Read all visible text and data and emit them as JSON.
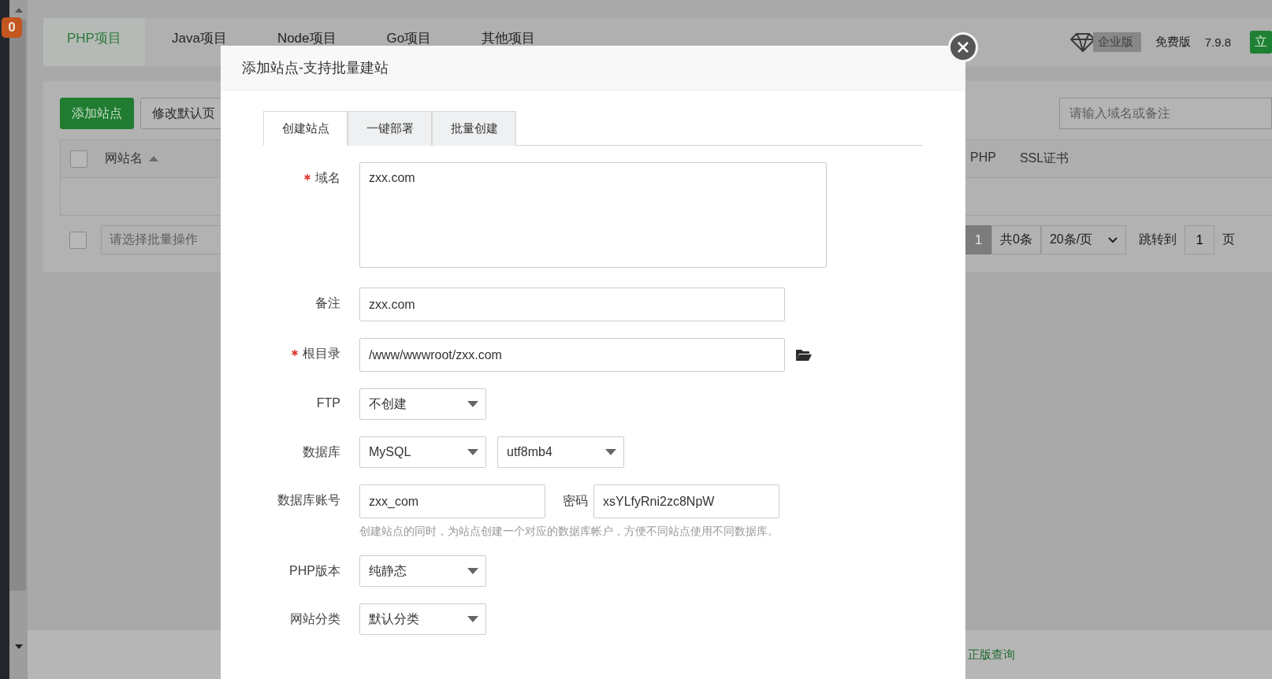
{
  "sidebar": {
    "badge": "0"
  },
  "project_tabs": [
    {
      "label": "PHP项目",
      "selected": true
    },
    {
      "label": "Java项目",
      "selected": false
    },
    {
      "label": "Node项目",
      "selected": false
    },
    {
      "label": "Go项目",
      "selected": false
    },
    {
      "label": "其他项目",
      "selected": false
    }
  ],
  "header_right": {
    "edition": "企业版",
    "plan": "免费版",
    "version": "7.9.8",
    "button": "立"
  },
  "toolbar": {
    "buttons": [
      {
        "label": "添加站点",
        "kind": "primary"
      },
      {
        "label": "修改默认页",
        "kind": "default"
      }
    ],
    "search": {
      "placeholder": "请输入域名或备注"
    }
  },
  "table": {
    "select_all": {
      "checked": false
    },
    "columns": [
      {
        "label": "网站名",
        "sorted": true
      },
      {
        "label": "PHP"
      },
      {
        "label": "SSL证书"
      }
    ]
  },
  "batch": {
    "checked": false,
    "placeholder": "请选择批量操作"
  },
  "pagination": {
    "pages": [
      {
        "label": "1",
        "selected": true
      }
    ],
    "total": "共0条",
    "page_size": "20条/页",
    "jump_label": "跳转到",
    "jump_value": "1",
    "page_unit": "页"
  },
  "footer_link": "正版查询",
  "dialog": {
    "title": "添加站点-支持批量建站",
    "tabs": [
      {
        "label": "创建站点",
        "selected": true
      },
      {
        "label": "一键部署",
        "selected": false
      },
      {
        "label": "批量创建",
        "selected": false
      }
    ],
    "fields": [
      {
        "kind": "textarea",
        "label": "域名",
        "required": true,
        "value": "zxx.com"
      },
      {
        "kind": "input",
        "label": "备注",
        "required": false,
        "value": "zxx.com"
      },
      {
        "kind": "path",
        "label": "根目录",
        "required": true,
        "value": "/www/wwwroot/zxx.com"
      },
      {
        "kind": "select",
        "label": "FTP",
        "required": false,
        "selects": [
          "不创建"
        ]
      },
      {
        "kind": "select",
        "label": "数据库",
        "required": false,
        "selects": [
          "MySQL",
          "utf8mb4"
        ]
      },
      {
        "kind": "credentials",
        "label": "数据库账号",
        "required": false,
        "value": "zxx_com",
        "password_label": "密码",
        "password": "xsYLfyRni2zc8NpW",
        "hint": "创建站点的同时，为站点创建一个对应的数据库帐户，方便不同站点使用不同数据库。"
      },
      {
        "kind": "select",
        "label": "PHP版本",
        "required": false,
        "selects": [
          "纯静态"
        ]
      },
      {
        "kind": "select",
        "label": "网站分类",
        "required": false,
        "selects": [
          "默认分类"
        ]
      }
    ]
  }
}
